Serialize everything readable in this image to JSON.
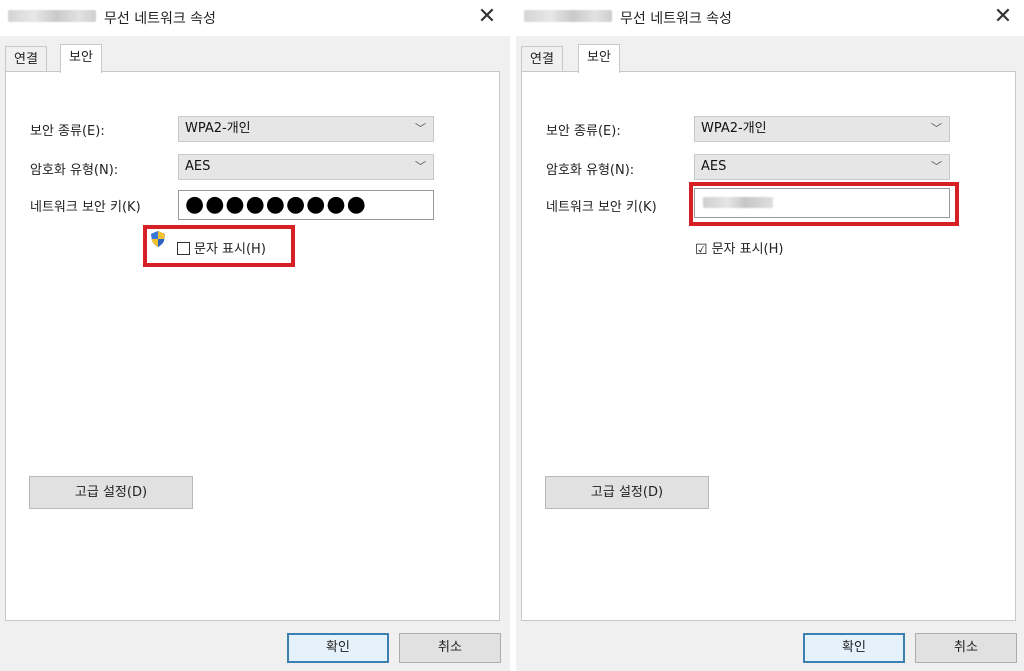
{
  "dialogs": [
    {
      "title": "무선 네트워크 속성",
      "close": "✕",
      "tabs": [
        "연결",
        "보안"
      ],
      "security_type": {
        "label": "보안 종류(E):",
        "value": "WPA2-개인"
      },
      "encryption_type": {
        "label": "암호화 유형(N):",
        "value": "AES"
      },
      "network_key": {
        "label": "네트워크 보안 키(K)",
        "value": "●●●●●●●●●"
      },
      "show_chars": {
        "label": "문자 표시(H)",
        "checked": false,
        "icon": "uac-shield-icon"
      },
      "advanced_button": "고급 설정(D)",
      "ok_button": "확인",
      "cancel_button": "취소"
    },
    {
      "title": "무선 네트워크 속성",
      "close": "✕",
      "tabs": [
        "연결",
        "보안"
      ],
      "security_type": {
        "label": "보안 종류(E):",
        "value": "WPA2-개인"
      },
      "encryption_type": {
        "label": "암호화 유형(N):",
        "value": "AES"
      },
      "network_key": {
        "label": "네트워크 보안 키(K)",
        "value": ""
      },
      "show_chars": {
        "label": "문자 표시(H)",
        "checked": true
      },
      "advanced_button": "고급 설정(D)",
      "ok_button": "확인",
      "cancel_button": "취소"
    }
  ],
  "checkmark": "☑",
  "dropdown_chevron": "﹀",
  "colors": {
    "highlight": "#d71f26",
    "primary_button_border": "#3c7fb1"
  }
}
